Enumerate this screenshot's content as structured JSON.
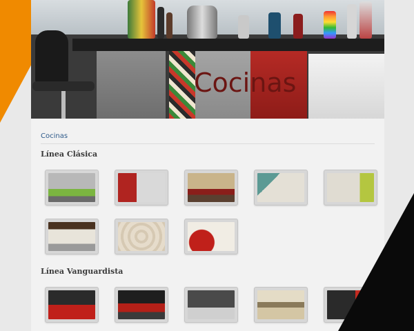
{
  "hero": {
    "title": "Cocinas"
  },
  "breadcrumb": {
    "label": "Cocinas"
  },
  "sections": [
    {
      "title": "Línea Clásica",
      "thumbnails": [
        {
          "icon": "kitchen-photo-icon"
        },
        {
          "icon": "kitchen-photo-icon"
        },
        {
          "icon": "kitchen-photo-icon"
        },
        {
          "icon": "kitchen-photo-icon"
        },
        {
          "icon": "kitchen-photo-icon"
        },
        {
          "icon": "kitchen-photo-icon"
        },
        {
          "icon": "kitchen-photo-icon"
        },
        {
          "icon": "kitchen-photo-icon"
        }
      ]
    },
    {
      "title": "Línea Vanguardista",
      "thumbnails": [
        {
          "icon": "kitchen-photo-icon"
        },
        {
          "icon": "kitchen-photo-icon"
        },
        {
          "icon": "kitchen-photo-icon"
        },
        {
          "icon": "kitchen-photo-icon"
        },
        {
          "icon": "kitchen-photo-icon"
        }
      ]
    }
  ],
  "colors": {
    "accent_orange": "#f08a00",
    "hero_title": "#6b1512",
    "breadcrumb_link": "#2d5a8a",
    "page_bg": "#f2f2f2"
  }
}
